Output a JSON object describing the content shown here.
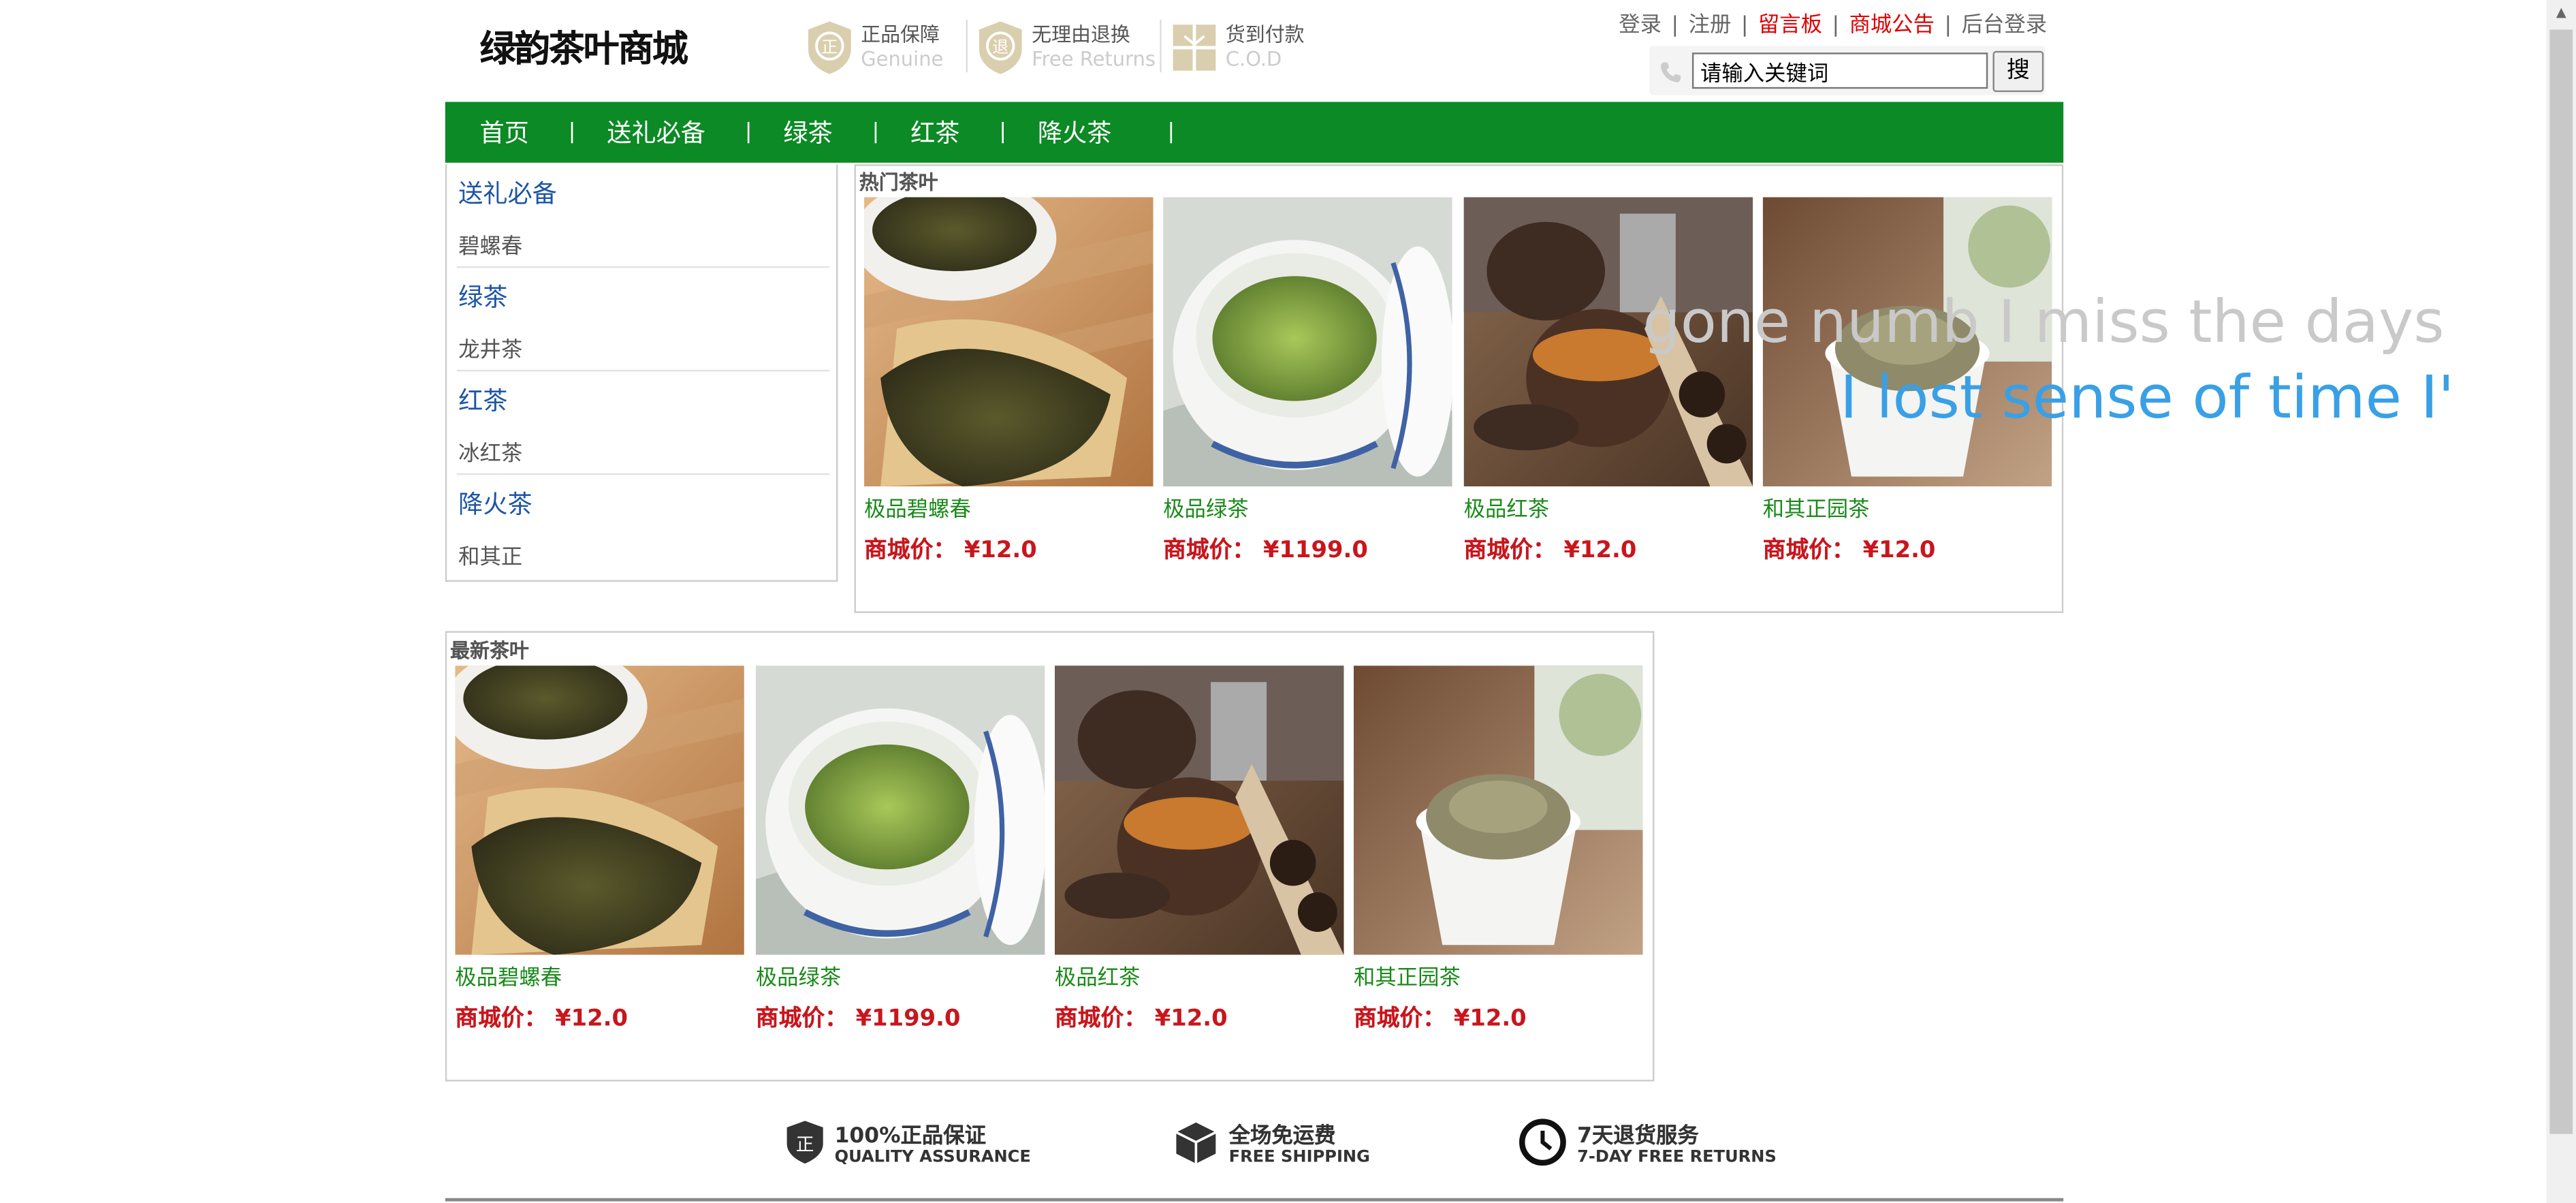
{
  "header": {
    "logo": "绿韵茶叶商城",
    "badges": [
      {
        "title": "正品保障",
        "sub": "Genuine",
        "icon": "genuine-shield-icon"
      },
      {
        "title": "无理由退换",
        "sub": "Free Returns",
        "icon": "return-shield-icon"
      },
      {
        "title": "货到付款",
        "sub": "C.O.D",
        "icon": "cod-box-icon"
      }
    ],
    "top_links": [
      "登录",
      "注册",
      "留言板",
      "商城公告",
      "后台登录"
    ],
    "search": {
      "value": "请输入关键词",
      "button": "搜"
    }
  },
  "nav": {
    "items": [
      "首页",
      "送礼必备",
      "绿茶",
      "红茶",
      "降火茶"
    ],
    "separator": "|"
  },
  "sidebar": {
    "groups": [
      {
        "category": "送礼必备",
        "item": "碧螺春"
      },
      {
        "category": "绿茶",
        "item": "龙井茶"
      },
      {
        "category": "红茶",
        "item": "冰红茶"
      },
      {
        "category": "降火茶",
        "item": "和其正"
      }
    ]
  },
  "hot": {
    "title": "热门茶叶",
    "products": [
      {
        "name": "极品碧螺春",
        "price_label": "商城价：",
        "price": "¥12.0"
      },
      {
        "name": "极品绿茶",
        "price_label": "商城价：",
        "price": "¥1199.0"
      },
      {
        "name": "极品红茶",
        "price_label": "商城价：",
        "price": "¥12.0"
      },
      {
        "name": "和其正园茶",
        "price_label": "商城价：",
        "price": "¥12.0"
      }
    ]
  },
  "newest": {
    "title": "最新茶叶",
    "products": [
      {
        "name": "极品碧螺春",
        "price_label": "商城价：",
        "price": "¥12.0"
      },
      {
        "name": "极品绿茶",
        "price_label": "商城价：",
        "price": "¥1199.0"
      },
      {
        "name": "极品红茶",
        "price_label": "商城价：",
        "price": "¥12.0"
      },
      {
        "name": "和其正园茶",
        "price_label": "商城价：",
        "price": "¥12.0"
      }
    ]
  },
  "overlay": {
    "line1": "gone numb I miss the days whe",
    "line2": "I lost sense of time I've"
  },
  "guarantees": [
    {
      "title": "100%正品保证",
      "sub": "QUALITY ASSURANCE",
      "icon": "quality-shield-icon"
    },
    {
      "title": "全场免运费",
      "sub": "FREE SHIPPING",
      "icon": "shipping-box-icon"
    },
    {
      "title": "7天退货服务",
      "sub": "7-DAY FREE RETURNS",
      "icon": "clock-icon"
    }
  ],
  "colors": {
    "nav_green": "#0c8a25",
    "price_red": "#c8161d",
    "link_blue": "#1d55a4",
    "product_green": "#1a8a1a"
  }
}
